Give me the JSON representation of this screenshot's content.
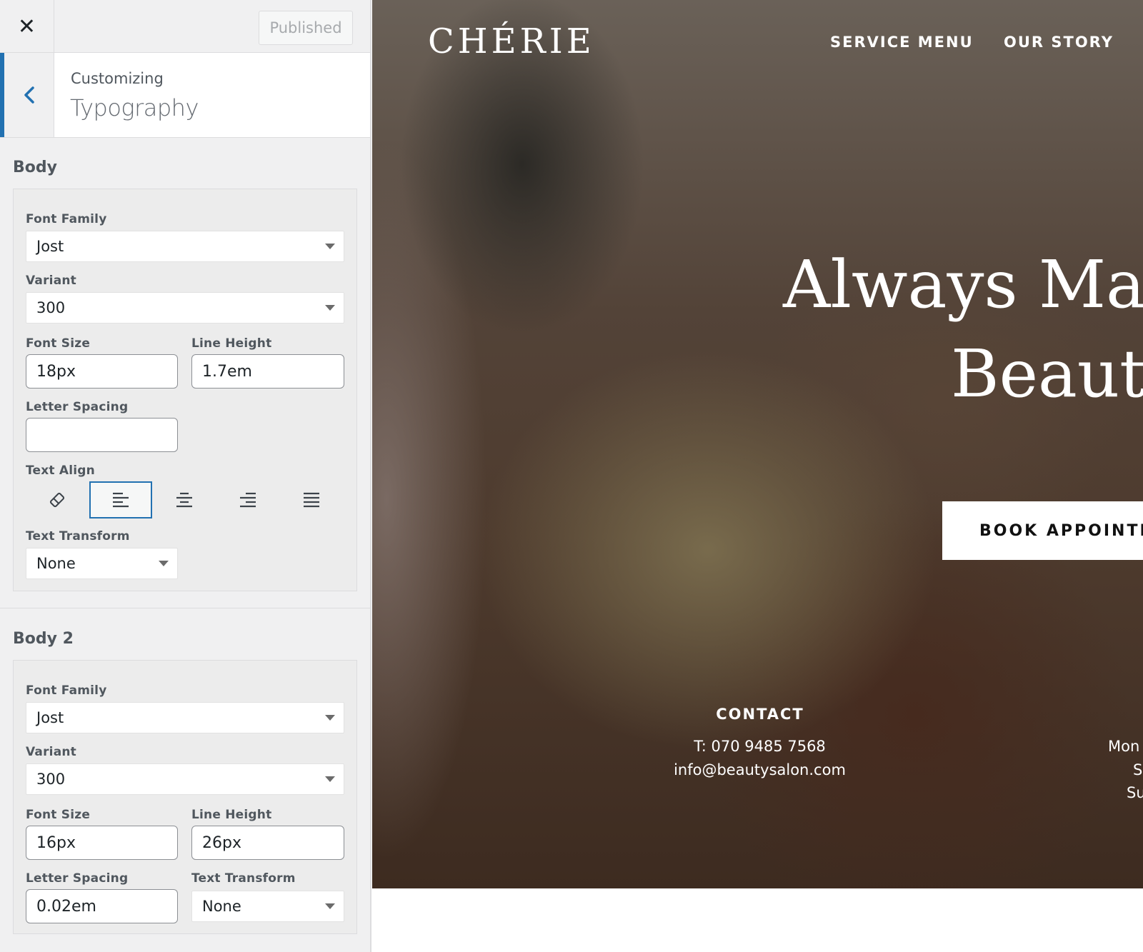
{
  "topbar": {
    "close_glyph": "✕",
    "publish_label": "Published"
  },
  "section": {
    "breadcrumb": "Customizing",
    "title": "Typography"
  },
  "body_group": {
    "title": "Body",
    "font_family_label": "Font Family",
    "font_family_value": "Jost",
    "variant_label": "Variant",
    "variant_value": "300",
    "font_size_label": "Font Size",
    "font_size_value": "18px",
    "line_height_label": "Line Height",
    "line_height_value": "1.7em",
    "letter_spacing_label": "Letter Spacing",
    "letter_spacing_value": "",
    "text_align_label": "Text Align",
    "text_align_selected": "left",
    "text_transform_label": "Text Transform",
    "text_transform_value": "None"
  },
  "body2_group": {
    "title": "Body 2",
    "font_family_label": "Font Family",
    "font_family_value": "Jost",
    "variant_label": "Variant",
    "variant_value": "300",
    "font_size_label": "Font Size",
    "font_size_value": "16px",
    "line_height_label": "Line Height",
    "line_height_value": "26px",
    "letter_spacing_label": "Letter Spacing",
    "letter_spacing_value": "0.02em",
    "text_transform_label": "Text Transform",
    "text_transform_value": "None"
  },
  "preview": {
    "logo": "CHÉRIE",
    "nav": [
      "SERVICE MENU",
      "OUR STORY"
    ],
    "hero_line1": "Always Make",
    "hero_line2": "Beauty",
    "cta": "BOOK APPOINTMENT",
    "contact_heading": "CONTACT",
    "contact_phone": "T: 070 9485 7568",
    "contact_email": "info@beautysalon.com",
    "hours_fragments": [
      "Mon",
      "S",
      "Su"
    ]
  },
  "colors": {
    "accent": "#2271b1",
    "panel_bg": "#f0f0f1"
  },
  "icons": [
    "close-icon",
    "chevron-left-icon",
    "eraser-icon",
    "align-left-icon",
    "align-center-icon",
    "align-right-icon",
    "align-justify-icon",
    "dropdown-caret-icon"
  ]
}
